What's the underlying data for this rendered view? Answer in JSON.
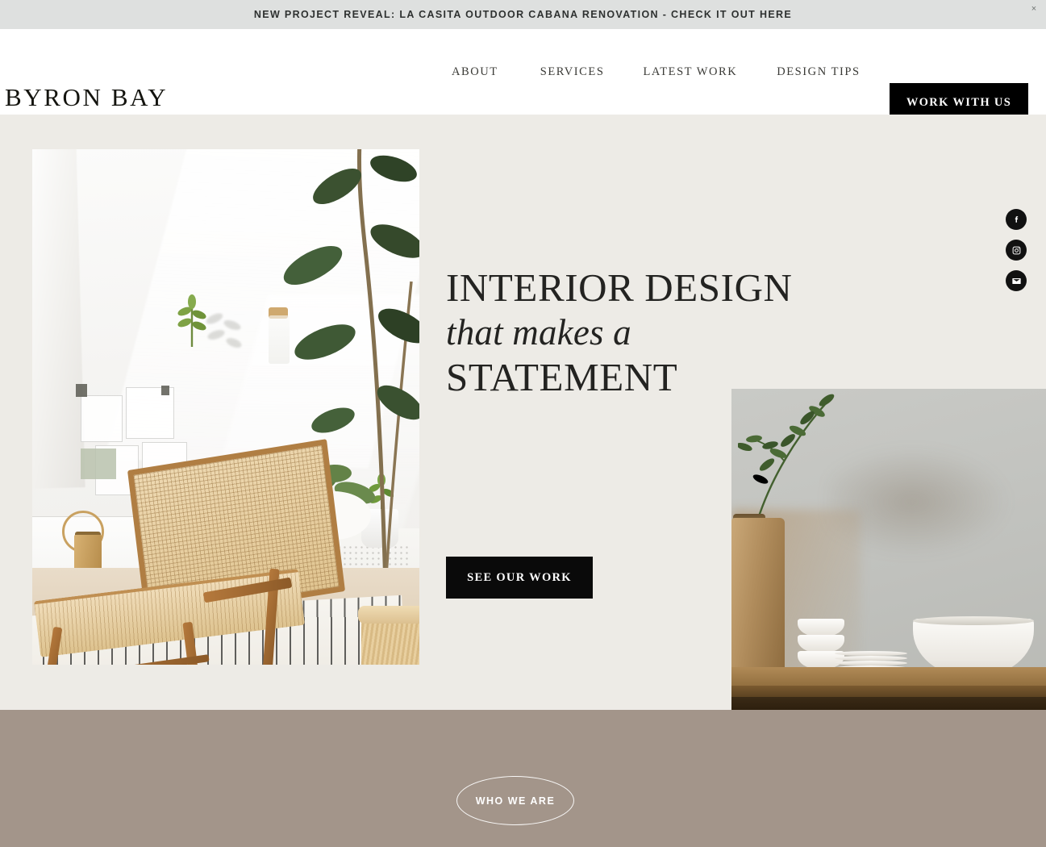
{
  "announcement": {
    "text": "NEW PROJECT REVEAL: LA CASITA OUTDOOR CABANA RENOVATION - CHECK IT OUT HERE",
    "close_icon": "close-icon",
    "close_glyph": "×",
    "background": "#DEE0DF"
  },
  "header": {
    "logo": "BYRON BAY",
    "nav": [
      {
        "label": "ABOUT"
      },
      {
        "label": "SERVICES"
      },
      {
        "label": "LATEST WORK"
      },
      {
        "label": "DESIGN TIPS"
      }
    ],
    "cta": {
      "label": "WORK WITH US",
      "background": "#000000",
      "color": "#FFFFFF"
    }
  },
  "hero": {
    "background": "#EDEBE6",
    "heading_line1": "INTERIOR DESIGN",
    "heading_line2": "that makes a",
    "heading_line3": "STATEMENT",
    "cta": {
      "label": "SEE OUR WORK",
      "background": "#0A0A0A",
      "color": "#FFFFFF"
    },
    "images": [
      {
        "name": "hero-image-left",
        "alt": "Sunlit room with rattan lounge chair, striped rug, brass watering can and rubber plant"
      },
      {
        "name": "hero-image-right",
        "alt": "Rustic wooden shelf with wooden vase holding olive branch, stacked white ceramic bowls and plates"
      }
    ]
  },
  "social": [
    {
      "name": "facebook-icon",
      "label": "Facebook"
    },
    {
      "name": "instagram-icon",
      "label": "Instagram"
    },
    {
      "name": "email-icon",
      "label": "Email"
    }
  ],
  "band": {
    "background": "#A3958A",
    "cta": {
      "label": "WHO WE ARE",
      "color": "#FFFFFF"
    }
  }
}
